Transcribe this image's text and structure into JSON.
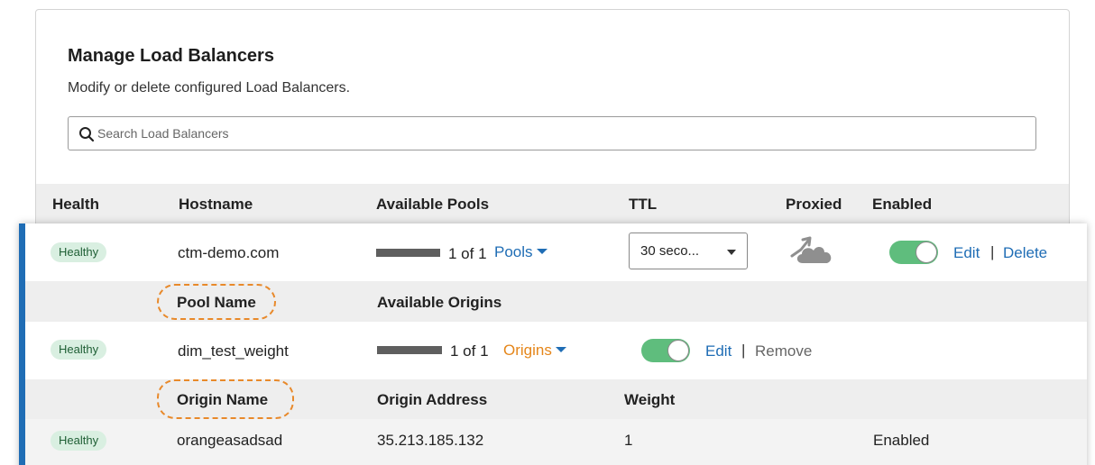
{
  "header": {
    "title": "Manage Load Balancers",
    "subtitle": "Modify or delete configured Load Balancers."
  },
  "search": {
    "placeholder": "Search Load Balancers",
    "icon": "search-icon"
  },
  "columns": {
    "health": "Health",
    "hostname": "Hostname",
    "pools": "Available Pools",
    "ttl": "TTL",
    "proxied": "Proxied",
    "enabled": "Enabled"
  },
  "load_balancer": {
    "health": "Healthy",
    "hostname": "ctm-demo.com",
    "pools_count": "1 of 1",
    "pools_link": "Pools",
    "ttl_value": "30 seco...",
    "proxied_icon": "cloud-proxied-icon",
    "enabled": true,
    "edit": "Edit",
    "separator": "|",
    "delete": "Delete"
  },
  "pool_header": {
    "name": "Pool Name",
    "origins": "Available Origins"
  },
  "pool": {
    "health": "Healthy",
    "name": "dim_test_weight",
    "origins_count": "1 of 1",
    "origins_link": "Origins",
    "enabled": true,
    "edit": "Edit",
    "separator": "|",
    "remove": "Remove"
  },
  "origin_header": {
    "name": "Origin Name",
    "address": "Origin Address",
    "weight": "Weight"
  },
  "origin": {
    "health": "Healthy",
    "name": "orangeasadsad",
    "address": "35.213.185.132",
    "weight": "1",
    "status": "Enabled"
  },
  "colors": {
    "accent": "#1f6db5",
    "healthy_bg": "#d9efe1",
    "toggle_on": "#5fbd7d",
    "highlight": "#e8892a",
    "origins_link": "#e5861a"
  }
}
